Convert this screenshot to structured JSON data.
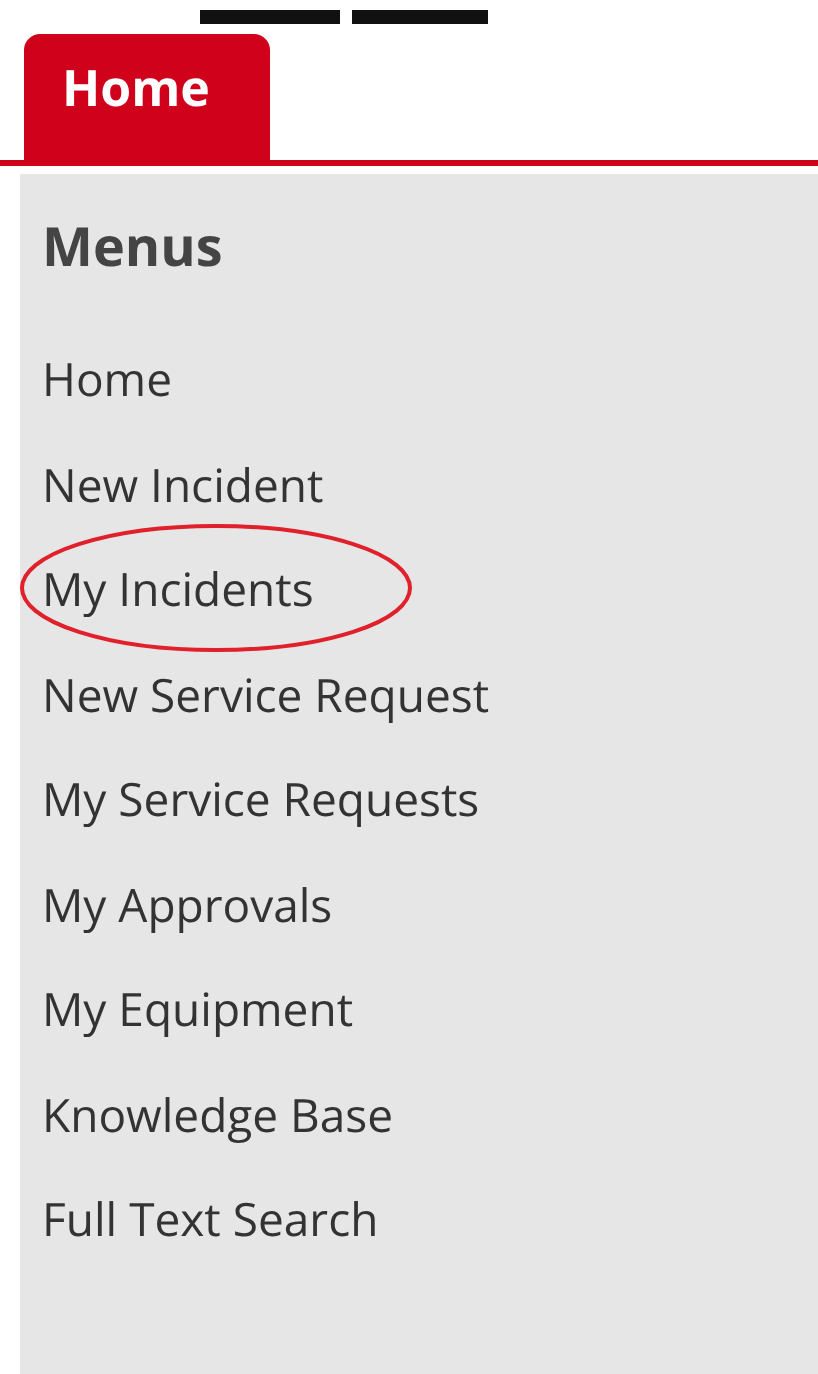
{
  "tabs": [
    {
      "label": "Home",
      "selected": true
    }
  ],
  "menu": {
    "title": "Menus",
    "items": [
      {
        "label": "Home",
        "circled": false
      },
      {
        "label": "New Incident",
        "circled": false
      },
      {
        "label": "My Incidents",
        "circled": true
      },
      {
        "label": "New Service Request",
        "circled": false
      },
      {
        "label": "My Service Requests",
        "circled": false
      },
      {
        "label": "My Approvals",
        "circled": false
      },
      {
        "label": "My Equipment",
        "circled": false
      },
      {
        "label": "Knowledge Base",
        "circled": false
      },
      {
        "label": "Full Text Search",
        "circled": false
      }
    ]
  }
}
